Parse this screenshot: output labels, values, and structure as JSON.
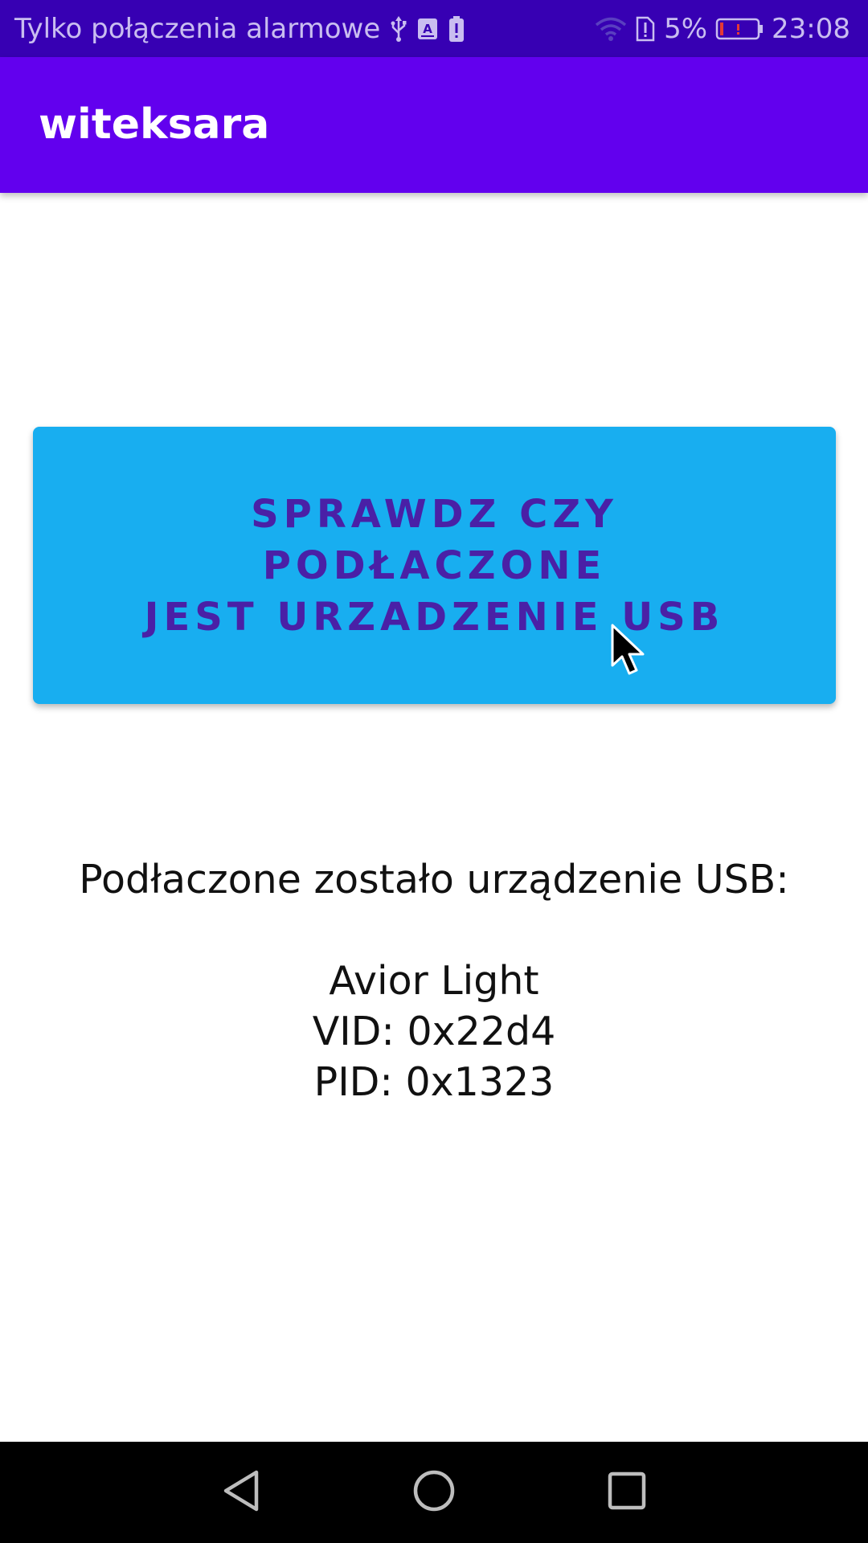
{
  "status_bar": {
    "carrier_text": "Tylko połączenia alarmowe",
    "battery_percent": "5%",
    "time": "23:08",
    "left_icons": [
      "usb-icon",
      "keyboard-a-icon",
      "battery-alert-icon"
    ],
    "right_icons": [
      "wifi-icon",
      "sim-alert-icon",
      "battery-low-icon"
    ]
  },
  "app_bar": {
    "title": "witeksara"
  },
  "main": {
    "check_button_label": "SPRAWDZ CZY PODŁACZONE\nJEST URZADZENIE USB",
    "result_header": "Podłaczone zostało urządzenie USB:",
    "device_name": "Avior Light",
    "vid": "VID: 0x22d4",
    "pid": "PID: 0x1323"
  },
  "nav_bar": {
    "buttons": [
      "back-icon",
      "home-icon",
      "recents-icon"
    ]
  },
  "colors": {
    "status_bar": "#3700b3",
    "app_bar": "#6200ee",
    "button": "#18aef0",
    "button_text": "#4a20a6"
  }
}
